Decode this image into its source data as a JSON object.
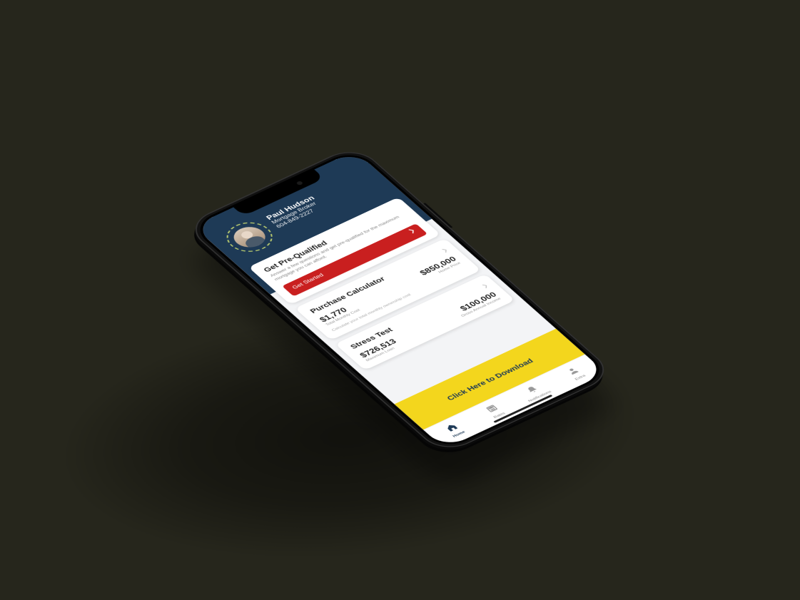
{
  "header": {
    "name": "Paul Hudson",
    "role": "Mortgage Broker",
    "phone": "604-849-2227"
  },
  "cards": {
    "prequal": {
      "title": "Get Pre-Qualified",
      "sub": "Answer a few questions and get pre-qualified for the maximum mortgage you can afford.",
      "cta": "Get Started"
    },
    "purchase": {
      "title": "Purchase Calculator",
      "v1": "$1,770",
      "l1": "Total Monthly Cost",
      "v2": "$850,000",
      "l2": "Home Price",
      "desc": "Calculate your total monthly ownership cost"
    },
    "stress": {
      "title": "Stress Test",
      "v1": "$726,513",
      "l1": "Maximum Loan",
      "v2": "$100,000",
      "l2": "Gross Annual Income"
    }
  },
  "download": "Click Here to Download",
  "tabs": {
    "home": "Home",
    "rates": "Rates",
    "notifications": "Notifications",
    "extra": "Extra"
  }
}
